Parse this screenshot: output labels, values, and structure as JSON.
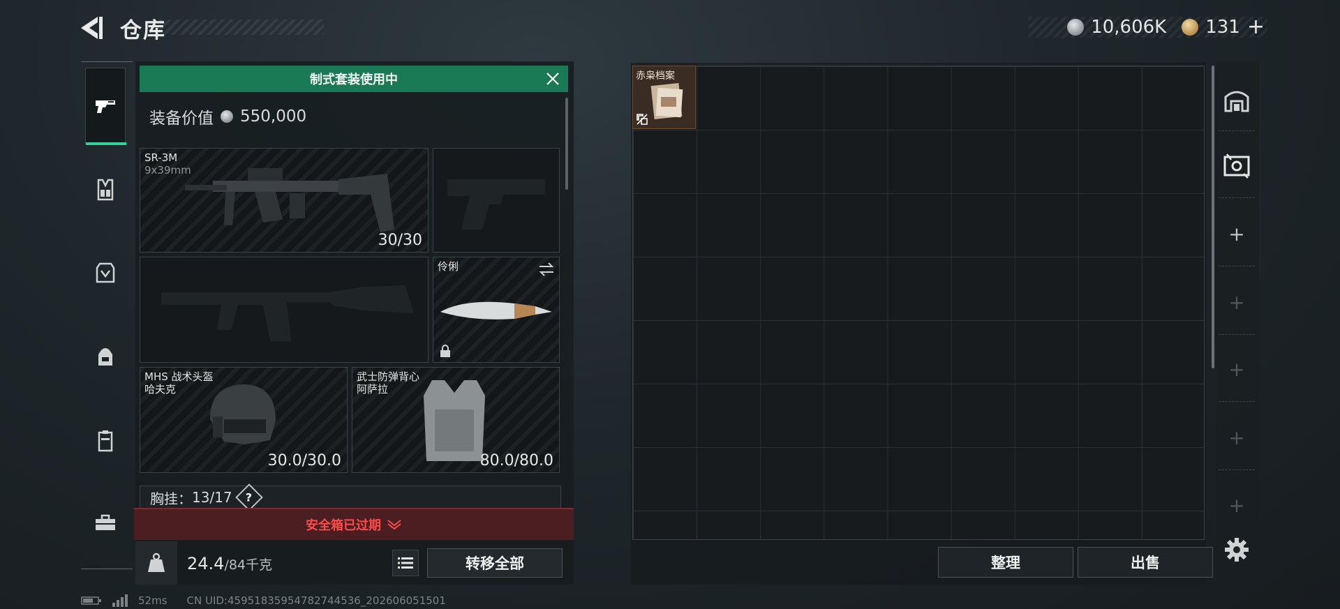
{
  "header": {
    "title": "仓库"
  },
  "currency": {
    "silver": "10,606K",
    "gold": "131",
    "add_label": "+"
  },
  "loadout": {
    "kit_banner": "制式套装使用中",
    "equip_value_label": "装备价值",
    "equip_value": "550,000",
    "primary_weapon": {
      "name": "SR-3M",
      "caliber": "9x39mm",
      "ammo": "30/30"
    },
    "melee": {
      "name": "伶俐"
    },
    "helmet": {
      "name": "MHS 战术头盔",
      "sub": "哈夫克",
      "durability": "30.0/30.0"
    },
    "armor": {
      "name": "武士防弹背心",
      "sub": "阿萨拉",
      "durability": "80.0/80.0"
    },
    "chest_rig": {
      "label": "胸挂：",
      "capacity": "13/17",
      "help": "?"
    },
    "safe_box_status": "安全箱已过期",
    "weight": "24.4",
    "weight_max": "/84千克",
    "transfer_all_label": "转移全部"
  },
  "stash": {
    "items": [
      {
        "name": "赤枭档案"
      }
    ],
    "sort_label": "整理",
    "sell_label": "出售"
  },
  "status": {
    "ping": "52ms",
    "uid": "CN UID:4595183595478274453​6_202606051501"
  },
  "colors": {
    "accent_green": "#2fd39a",
    "banner_green": "#1a7a55",
    "alert_red": "#ff4a4a"
  }
}
